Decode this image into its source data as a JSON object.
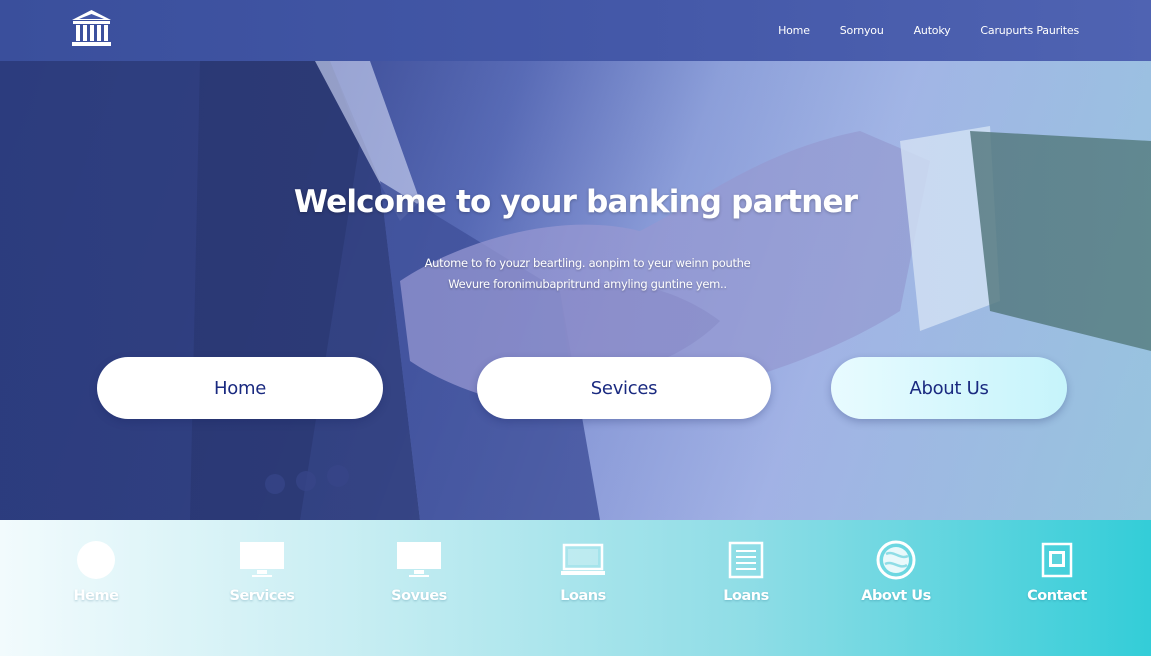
{
  "header": {
    "logo_icon": "bank-building-icon",
    "nav": [
      {
        "label": "Home"
      },
      {
        "label": "Sornyou"
      },
      {
        "label": "Autoky"
      },
      {
        "label": "Carupurts Paurites"
      }
    ]
  },
  "hero": {
    "title": "Welcome to your banking partner",
    "subtitle_line1": "Autome to fo youzr beartling. aonpim to  yeur weinn pouthe",
    "subtitle_line2": "Wevure foronimubapritrund amyling guntine yem..",
    "buttons": [
      {
        "label": "Home"
      },
      {
        "label": "Sevices"
      },
      {
        "label": "About Us"
      }
    ]
  },
  "bottom_nav": [
    {
      "label": "Heme",
      "icon": "circle-icon"
    },
    {
      "label": "Services",
      "icon": "monitor-icon"
    },
    {
      "label": "Sovues",
      "icon": "monitor-icon"
    },
    {
      "label": "Loans",
      "icon": "laptop-icon"
    },
    {
      "label": "Loans",
      "icon": "document-icon"
    },
    {
      "label": "Abovt Us",
      "icon": "globe-icon"
    },
    {
      "label": "Contact",
      "icon": "contact-card-icon"
    }
  ],
  "colors": {
    "header": "#4458a8",
    "button_text": "#1a2a80",
    "bottom_end": "#33cdd8"
  }
}
